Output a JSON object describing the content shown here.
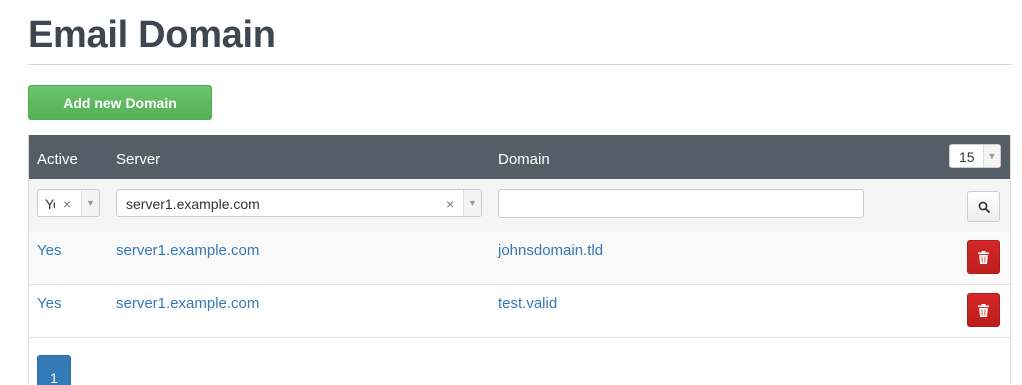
{
  "page": {
    "title": "Email Domain"
  },
  "toolbar": {
    "add_label": "Add new Domain"
  },
  "table": {
    "columns": {
      "active": "Active",
      "server": "Server",
      "domain": "Domain"
    },
    "page_size": "15",
    "filters": {
      "active_value": "Yes",
      "server_value": "server1.example.com",
      "domain_value": ""
    },
    "rows": [
      {
        "active": "Yes",
        "server": "server1.example.com",
        "domain": "johnsdomain.tld"
      },
      {
        "active": "Yes",
        "server": "server1.example.com",
        "domain": "test.valid"
      }
    ]
  },
  "pagination": {
    "current": "1"
  },
  "icons": {
    "search": "magnifier-icon",
    "delete": "trash-icon",
    "clear": "x-icon",
    "dropdown": "caret-down-icon"
  },
  "colors": {
    "header_bg": "#555e67",
    "link": "#337ab7",
    "success": "#5cb85c",
    "danger": "#c9302c"
  }
}
